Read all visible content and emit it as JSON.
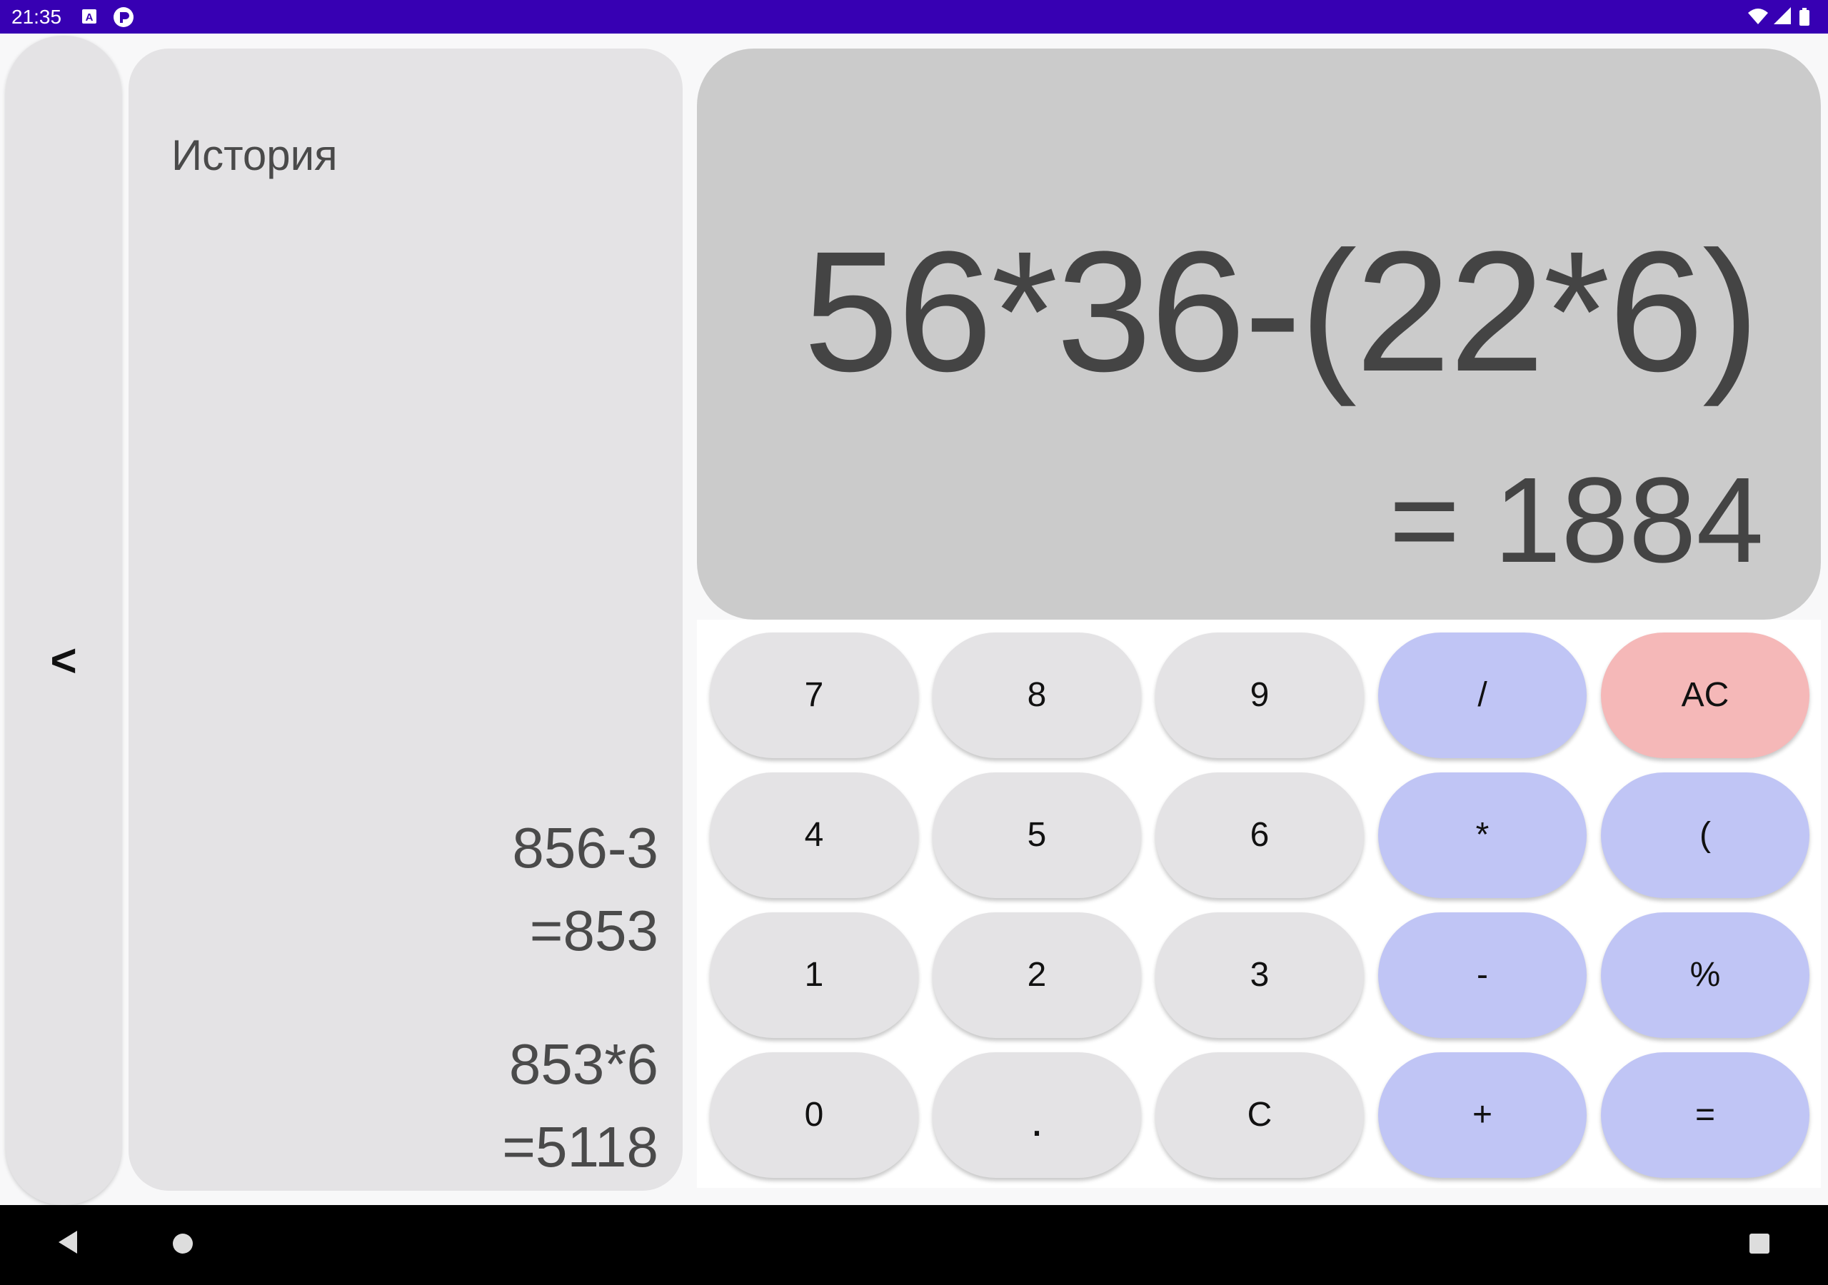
{
  "status_bar": {
    "time": "21:35",
    "left_icons": [
      "keyboard-a-icon",
      "notification-app-icon"
    ],
    "right_icons": [
      "wifi-icon",
      "signal-icon",
      "battery-icon"
    ]
  },
  "back_panel": {
    "label": "<"
  },
  "history": {
    "title": "История",
    "entries": [
      {
        "expression": "856-3",
        "result": "=853"
      },
      {
        "expression": "853*6",
        "result": "=5118"
      }
    ]
  },
  "display": {
    "expression": "56*36-(22*6)",
    "result": "= 1884"
  },
  "keypad": {
    "rows": [
      [
        {
          "label": "7",
          "type": "digit"
        },
        {
          "label": "8",
          "type": "digit"
        },
        {
          "label": "9",
          "type": "digit"
        },
        {
          "label": "/",
          "type": "operator"
        },
        {
          "label": "AC",
          "type": "clear"
        }
      ],
      [
        {
          "label": "4",
          "type": "digit"
        },
        {
          "label": "5",
          "type": "digit"
        },
        {
          "label": "6",
          "type": "digit"
        },
        {
          "label": "*",
          "type": "operator"
        },
        {
          "label": "(",
          "type": "operator"
        }
      ],
      [
        {
          "label": "1",
          "type": "digit"
        },
        {
          "label": "2",
          "type": "digit"
        },
        {
          "label": "3",
          "type": "digit"
        },
        {
          "label": "-",
          "type": "operator"
        },
        {
          "label": "%",
          "type": "operator"
        }
      ],
      [
        {
          "label": "0",
          "type": "digit"
        },
        {
          "label": ".",
          "type": "digit"
        },
        {
          "label": "C",
          "type": "digit"
        },
        {
          "label": "+",
          "type": "operator"
        },
        {
          "label": "=",
          "type": "operator"
        }
      ]
    ]
  },
  "colors": {
    "status_bar": "#3700b3",
    "key_digit": "#e4e3e5",
    "key_operator": "#c0c5f5",
    "key_clear": "#f5b8b8",
    "display_bg": "#cbcbcb"
  },
  "nav_bar": {
    "icons": [
      "back-triangle-icon",
      "home-circle-icon",
      "recents-square-icon"
    ]
  }
}
